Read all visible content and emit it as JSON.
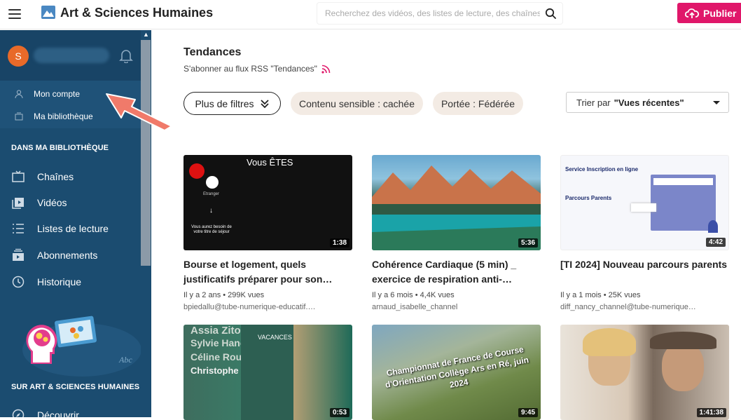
{
  "header": {
    "app_title": "Art & Sciences Humaines",
    "search_placeholder": "Recherchez des vidéos, des listes de lecture, des chaînes",
    "publish_label": "Publier"
  },
  "sidebar": {
    "avatar_letter": "S",
    "account_items": [
      {
        "label": "Mon compte",
        "icon": "user-icon"
      },
      {
        "label": "Ma bibliothèque",
        "icon": "library-icon"
      }
    ],
    "section_library": "DANS MA BIBLIOTHÈQUE",
    "library_items": [
      {
        "label": "Chaînes",
        "icon": "tv-icon"
      },
      {
        "label": "Vidéos",
        "icon": "video-icon"
      },
      {
        "label": "Listes de lecture",
        "icon": "playlist-icon"
      },
      {
        "label": "Abonnements",
        "icon": "subscriptions-icon"
      },
      {
        "label": "Historique",
        "icon": "history-icon"
      }
    ],
    "promo_text": "Abc",
    "section_instance": "SUR ART & SCIENCES HUMAINES",
    "instance_items": [
      {
        "label": "Découvrir",
        "icon": "discover-icon"
      }
    ]
  },
  "main": {
    "title": "Tendances",
    "rss_text": "S'abonner au flux RSS \"Tendances\"",
    "filter_button": "Plus de filtres",
    "pills": [
      "Contenu sensible : cachée",
      "Portée : Fédérée"
    ],
    "sort_prefix": "Trier par",
    "sort_value": "\"Vues récentes\""
  },
  "videos": [
    {
      "title": "Bourse et logement, quels justificatifs préparer pour son…",
      "meta": "Il y a 2 ans • 299K vues",
      "channel": "bpiedallu@tube-numerique-educatif.…",
      "duration": "1:38",
      "thumb_text": "Vous ÊTES",
      "thumb_sub1": "Etranger",
      "thumb_sub2": "Vous aurez besoin de votre titre de séjour"
    },
    {
      "title": "Cohérence Cardiaque (5 min) _ exercice de respiration anti-…",
      "meta": "Il y a 6 mois • 4,4K vues",
      "channel": "arnaud_isabelle_channel",
      "duration": "5:36"
    },
    {
      "title": "[TI 2024] Nouveau parcours parents",
      "meta": "Il y a 1 mois • 25K vues",
      "channel": "diff_nancy_channel@tube-numerique…",
      "duration": "4:42",
      "thumb_text": "Service Inscription en ligne",
      "thumb_sub1": "Parcours Parents"
    },
    {
      "title": "",
      "meta": "",
      "channel": "",
      "duration": "0:53",
      "thumb_text": "Assia Zitoun",
      "thumb_sub1": "Sylvie Hanot",
      "thumb_sub2": "Céline Rousse",
      "thumb_sub3": "Christophe S",
      "thumb_sub4": "VACANCES"
    },
    {
      "title": "",
      "meta": "",
      "channel": "",
      "duration": "9:45",
      "thumb_text": "Championnat de France de Course d'Orientation Collège Ars en Ré, juin 2024"
    },
    {
      "title": "",
      "meta": "",
      "channel": "",
      "duration": "1:41:38"
    }
  ],
  "colors": {
    "sidebar_bg": "#1b4c70",
    "accent": "#e0176a",
    "avatar": "#e86a29",
    "arrow": "#f07a6a"
  }
}
